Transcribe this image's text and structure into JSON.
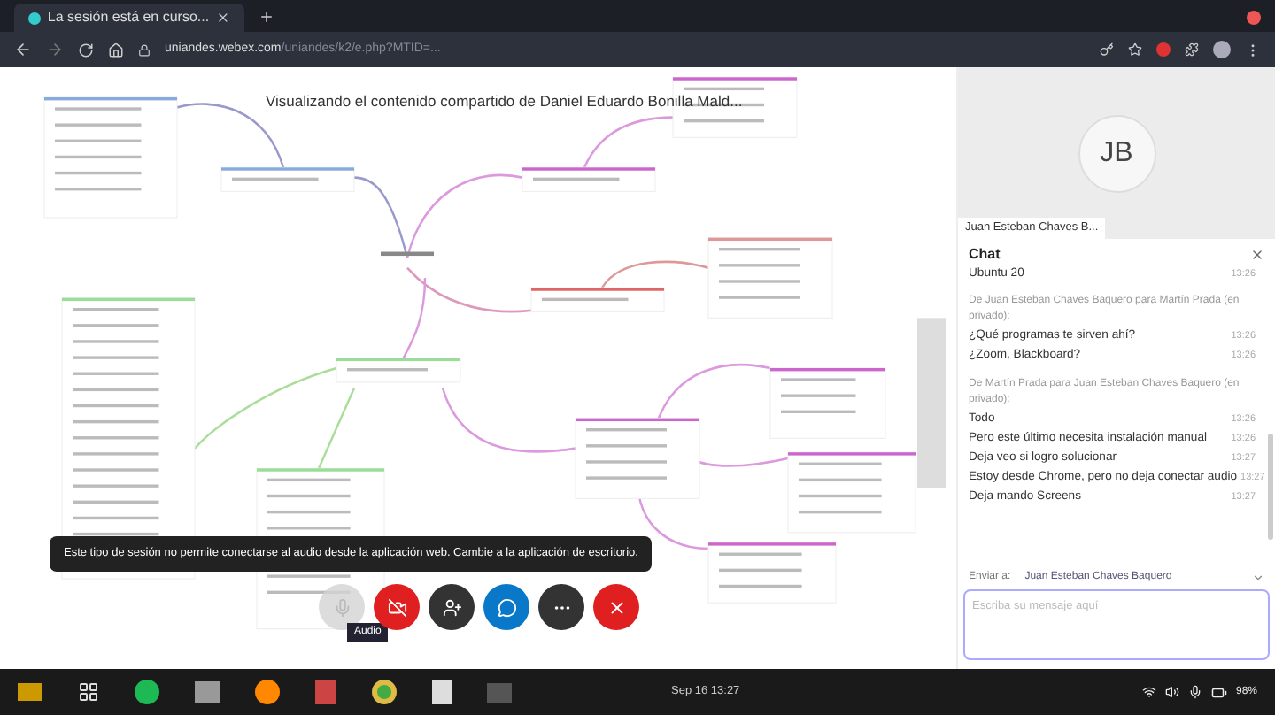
{
  "browser": {
    "tab": {
      "title": "La sesión está en curso..."
    },
    "address": {
      "domain": "uniandes.webex.com",
      "path": "/uniandes/k2/e.php?MTID=..."
    }
  },
  "share": {
    "title": "Visualizando el contenido compartido de Daniel Eduardo Bonilla Mald..."
  },
  "tooltip": "Este tipo de sesión no permite conectarse al audio desde la aplicación web. Cambie a la aplicación de escritorio.",
  "controls": [
    {
      "kind": "audio",
      "disabled": true,
      "hint": "Audio"
    },
    {
      "kind": "video",
      "disabled": false
    },
    {
      "kind": "participants",
      "disabled": false
    },
    {
      "kind": "chat",
      "disabled": false
    },
    {
      "kind": "more",
      "disabled": false
    },
    {
      "kind": "leave",
      "disabled": false
    }
  ],
  "participant": {
    "initials": "JB",
    "name": "Juan Esteban Chaves B..."
  },
  "chat": {
    "title": "Chat",
    "messages": [
      {
        "kind": "message",
        "text": "Ubuntu 20",
        "time": "13:26"
      },
      {
        "kind": "header",
        "text": "De Juan Esteban Chaves Baquero para Martín Prada (en privado):"
      },
      {
        "kind": "message",
        "text": "¿Qué programas te sirven ahí?",
        "time": "13:26"
      },
      {
        "kind": "message",
        "text": "¿Zoom, Blackboard?",
        "time": "13:26"
      },
      {
        "kind": "header",
        "text": "De Martín Prada para Juan Esteban Chaves Baquero (en privado):"
      },
      {
        "kind": "message",
        "text": "Todo",
        "time": "13:26"
      },
      {
        "kind": "message",
        "text": "Pero este último necesita instalación manual",
        "time": "13:26"
      },
      {
        "kind": "message",
        "text": "Deja veo si logro solucionar",
        "time": "13:27"
      },
      {
        "kind": "message",
        "text": "Estoy desde Chrome, pero no deja conectar audio",
        "time": "13:27"
      },
      {
        "kind": "message",
        "text": "Deja mando Screens",
        "time": "13:27"
      }
    ],
    "send_to": {
      "label": "Enviar a:",
      "value": "Juan Esteban Chaves Baquero"
    },
    "input": {
      "placeholder": "Escriba su mensaje aquí"
    }
  },
  "taskbar": {
    "clock": "Sep 16 13:27",
    "battery": "98%"
  }
}
